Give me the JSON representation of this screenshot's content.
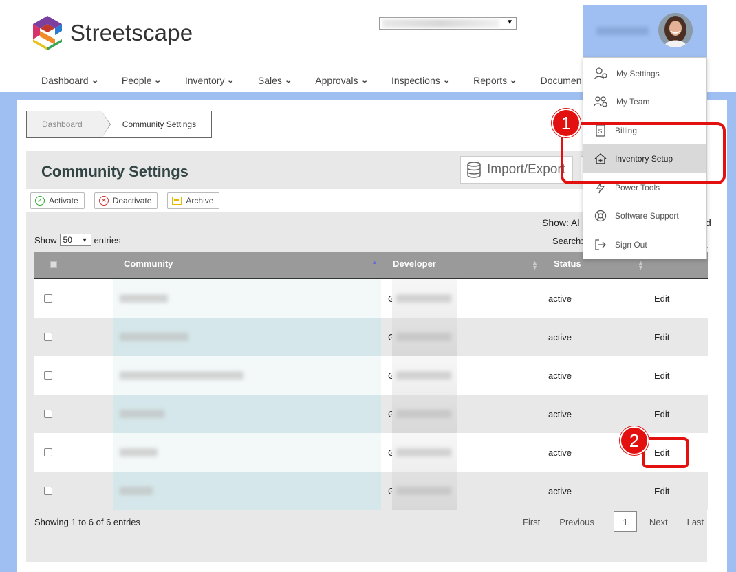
{
  "brand": {
    "name": "Streetscape"
  },
  "nav": {
    "items": [
      "Dashboard",
      "People",
      "Inventory",
      "Sales",
      "Approvals",
      "Inspections",
      "Reports",
      "Documen"
    ]
  },
  "breadcrumb": {
    "items": [
      "Dashboard",
      "Community Settings"
    ]
  },
  "page": {
    "title": "Community Settings",
    "import_export": "Import/Export"
  },
  "actions": {
    "activate": "Activate",
    "deactivate": "Deactivate",
    "archive": "Archive"
  },
  "table": {
    "show_label": "Show",
    "entries_value": "50",
    "entries_label": "entries",
    "filter_label": "Show: Al",
    "filter_tail": "d",
    "search_label": "Search:",
    "columns": {
      "community": "Community",
      "developer": "Developer",
      "status": "Status"
    },
    "rows": [
      {
        "developer_prefix": "G",
        "status": "active",
        "action": "Edit"
      },
      {
        "developer_prefix": "G",
        "status": "active",
        "action": "Edit"
      },
      {
        "developer_prefix": "G",
        "status": "active",
        "action": "Edit"
      },
      {
        "developer_prefix": "G",
        "status": "active",
        "action": "Edit"
      },
      {
        "developer_prefix": "G",
        "status": "active",
        "action": "Edit"
      },
      {
        "developer_prefix": "G",
        "status": "active",
        "action": "Edit"
      }
    ],
    "showing": "Showing 1 to 6 of 6 entries",
    "pager": {
      "first": "First",
      "previous": "Previous",
      "current": "1",
      "next": "Next",
      "last": "Last"
    }
  },
  "user_menu": {
    "items": [
      "My Settings",
      "My Team",
      "Billing",
      "Inventory Setup",
      "Power Tools",
      "Software Support",
      "Sign Out"
    ],
    "active": "Inventory Setup"
  },
  "annotations": {
    "step1": "1",
    "step2": "2",
    "color": "#e31010"
  }
}
